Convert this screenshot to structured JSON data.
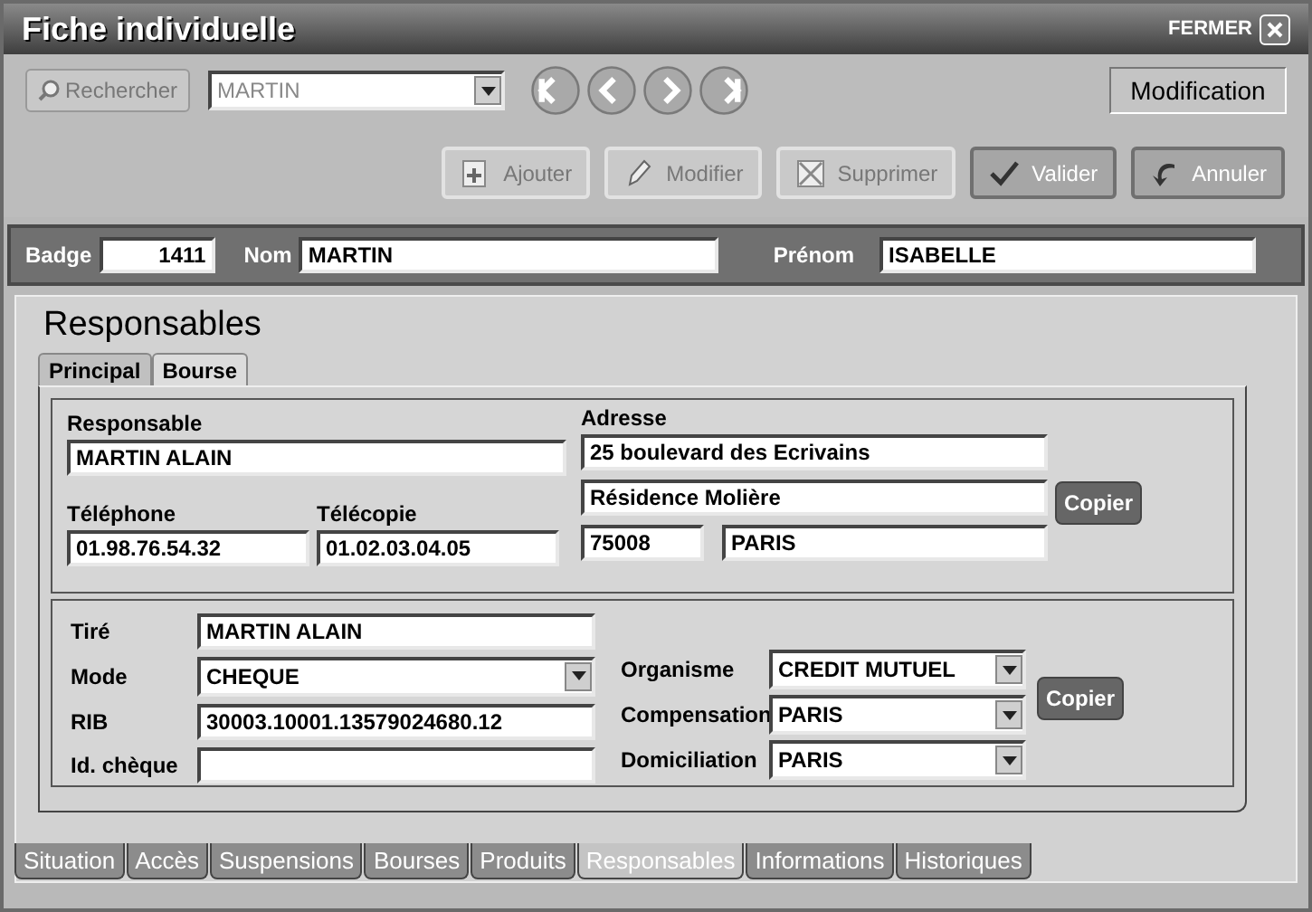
{
  "window": {
    "title": "Fiche individuelle",
    "close_label": "FERMER"
  },
  "toolbar": {
    "search_button": {
      "label": "Rechercher",
      "disabled": true
    },
    "search_value": "MARTIN",
    "mode": "Modification",
    "actions": [
      {
        "label": "Ajouter",
        "kind": "add",
        "disabled": true
      },
      {
        "label": "Modifier",
        "kind": "edit",
        "disabled": true
      },
      {
        "label": "Supprimer",
        "kind": "delete",
        "disabled": true
      },
      {
        "label": "Valider",
        "kind": "validate",
        "disabled": false
      },
      {
        "label": "Annuler",
        "kind": "cancel",
        "disabled": false
      }
    ]
  },
  "identity": {
    "badge_label": "Badge",
    "badge": "1411",
    "nom_label": "Nom",
    "nom": "MARTIN",
    "prenom_label": "Prénom",
    "prenom": "ISABELLE"
  },
  "section_title": "Responsables",
  "subtabs": [
    {
      "label": "Principal",
      "selected": true
    },
    {
      "label": "Bourse",
      "selected": false
    }
  ],
  "responsable": {
    "responsable_label": "Responsable",
    "responsable": "MARTIN ALAIN",
    "adresse_label": "Adresse",
    "adresse_1": "25 boulevard des Ecrivains",
    "adresse_2": "Résidence Molière",
    "telephone_label": "Téléphone",
    "telephone": "01.98.76.54.32",
    "telecopie_label": "Télécopie",
    "telecopie": "01.02.03.04.05",
    "code_postal": "75008",
    "ville": "PARIS",
    "copy_button": "Copier"
  },
  "paiement": {
    "tire_label": "Tiré",
    "tire": "MARTIN ALAIN",
    "mode_label": "Mode",
    "mode": "CHEQUE",
    "rib_label": "RIB",
    "rib": "30003.10001.13579024680.12",
    "id_cheque_label": "Id. chèque",
    "organisme_label": "Organisme",
    "organisme": "CREDIT MUTUEL",
    "compensation_label": "Compensation",
    "compensation": "PARIS",
    "domiciliation_label": "Domiciliation",
    "domiciliation": "PARIS",
    "copy_button": "Copier"
  },
  "tabs": [
    {
      "label": "Situation",
      "selected": false
    },
    {
      "label": "Accès",
      "selected": false
    },
    {
      "label": "Suspensions",
      "selected": false
    },
    {
      "label": "Bourses",
      "selected": false
    },
    {
      "label": "Produits",
      "selected": false
    },
    {
      "label": "Responsables",
      "selected": true
    },
    {
      "label": "Informations",
      "selected": false
    },
    {
      "label": "Historiques",
      "selected": false
    }
  ]
}
